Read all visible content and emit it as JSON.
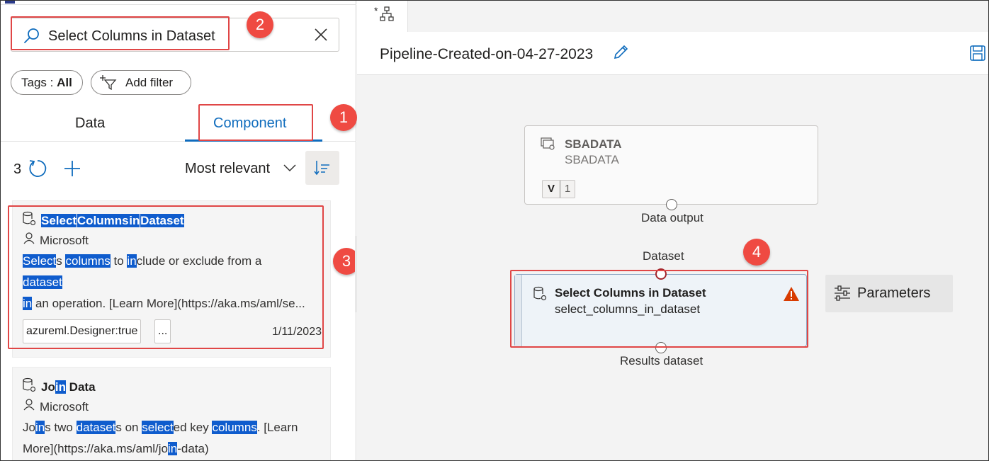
{
  "search": {
    "value": "Select Columns in Dataset"
  },
  "filters": {
    "tags_prefix": "Tags :",
    "tags_value": "All",
    "add_filter": "Add filter"
  },
  "tabs": [
    {
      "label": "Data"
    },
    {
      "label": "Component"
    }
  ],
  "toolbar": {
    "count": "3",
    "sort_label": "Most relevant"
  },
  "cards": [
    {
      "title_parts": [
        "Select",
        "Columns",
        "in",
        "Dataset"
      ],
      "author": "Microsoft",
      "desc_line1": [
        "Select",
        "s ",
        "columns",
        " to ",
        "in",
        "clude or exclude from a"
      ],
      "desc_line2": "dataset",
      "desc_line3_hl": "in",
      "desc_line3": " an operation. [Learn More](https://aka.ms/aml/se...",
      "tag": "azureml.Designer:true",
      "more": "...",
      "date": "1/11/2023"
    },
    {
      "title_parts": [
        "Jo",
        "in",
        " Data"
      ],
      "author": "Microsoft",
      "desc_line1": [
        "Jo",
        "in",
        "s two ",
        "dataset",
        "s on ",
        "select",
        "ed key ",
        "columns",
        ". [Learn"
      ],
      "desc_line2": [
        "More](https://aka.ms/aml/jo",
        "in",
        "-data)"
      ]
    }
  ],
  "annotations": [
    "1",
    "2",
    "3",
    "4"
  ],
  "canvas": {
    "pipeline_title": "Pipeline-Created-on-04-27-2023",
    "tab_marker": "*",
    "dataset_node": {
      "title": "SBADATA",
      "subtitle": "SBADATA",
      "version_label": "V",
      "version": "1",
      "output_label": "Data output"
    },
    "component_node": {
      "input_label": "Dataset",
      "title": "Select Columns in Dataset",
      "subtitle": "select_columns_in_dataset",
      "output_label": "Results dataset"
    },
    "parameters_label": "Parameters"
  },
  "colors": {
    "accent": "#0f6cbd",
    "highlight": "#0f5ccd",
    "annotation": "#ef4a42",
    "warning": "#d83b01"
  }
}
